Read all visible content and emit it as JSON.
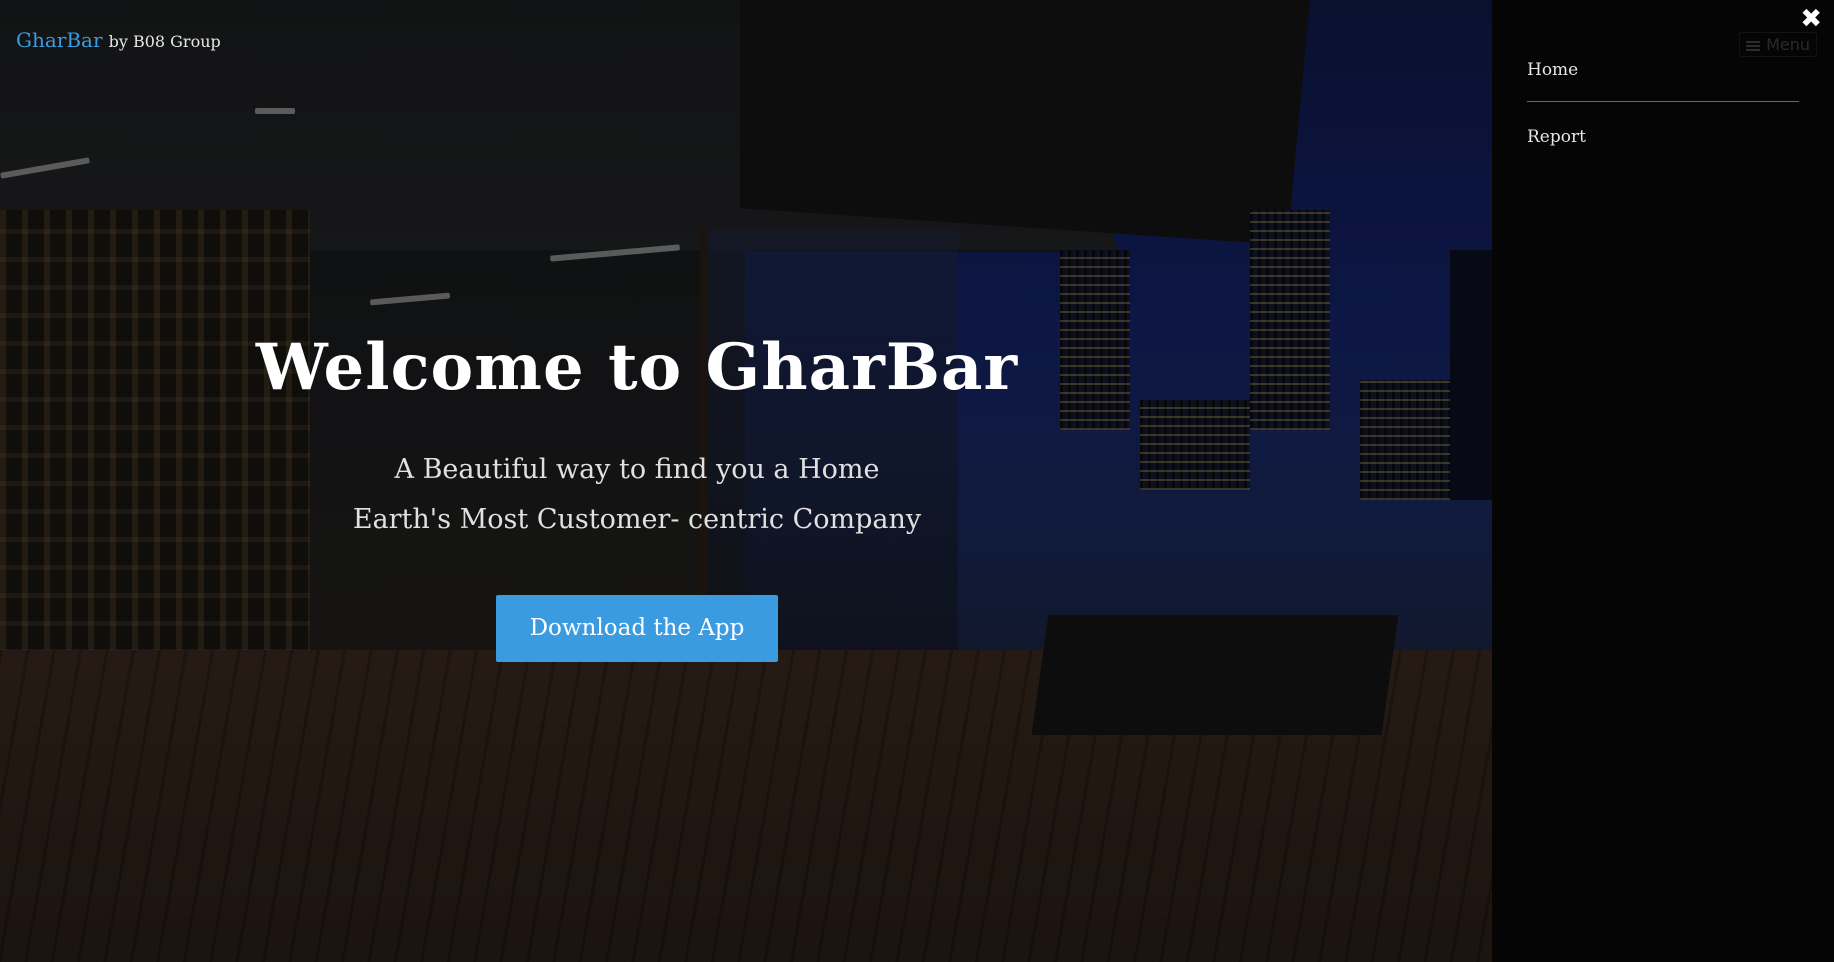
{
  "brand": {
    "name": "GharBar",
    "by": "by B08 Group"
  },
  "hero": {
    "title": "Welcome to GharBar",
    "subtitle_line1": "A Beautiful way to find you a Home",
    "subtitle_line2": "Earth's Most Customer- centric Company",
    "cta_label": "Download the App"
  },
  "sidebar": {
    "close_icon": "close-icon",
    "menu_toggle_label": "Menu",
    "items": [
      {
        "label": "Home"
      },
      {
        "label": "Report"
      }
    ]
  },
  "colors": {
    "accent": "#3a9be0",
    "sidebar_bg": "#050506",
    "text": "#ffffff"
  }
}
